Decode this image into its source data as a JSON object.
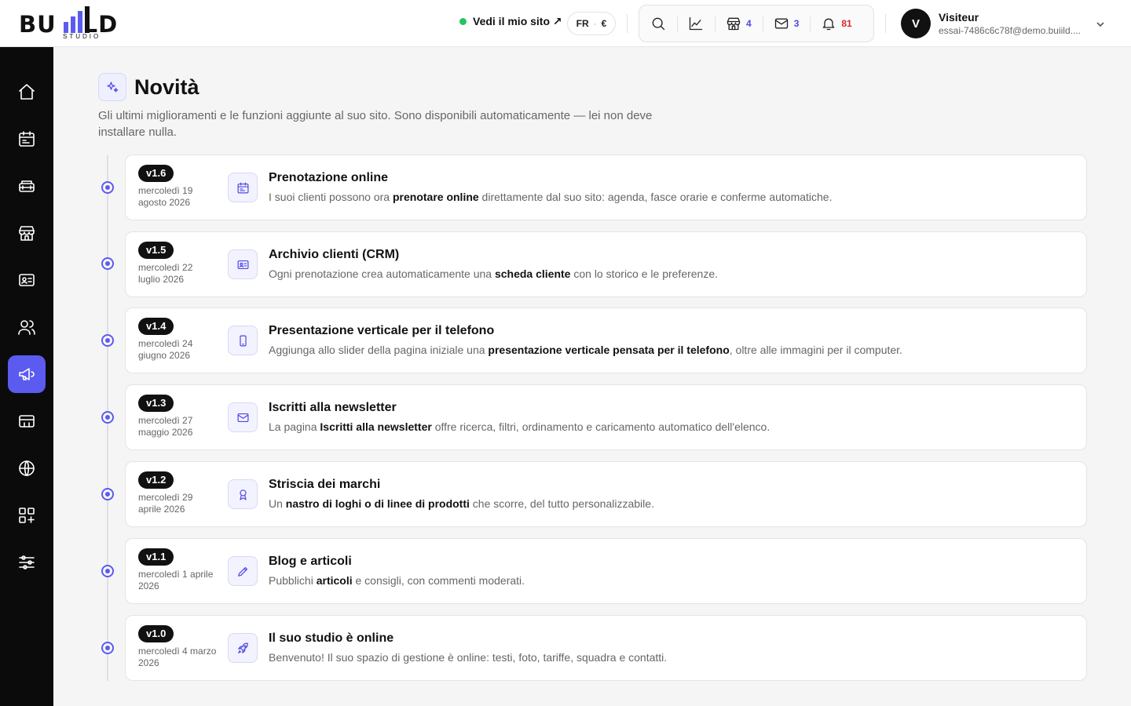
{
  "brand": {
    "name_left": "BU",
    "name_right": "LD",
    "sub": "STUDIO",
    "accent": "#5b5bf0"
  },
  "header": {
    "site_link": "Vedi il mio sito ↗",
    "lang": "FR",
    "currency": "€",
    "tools": [
      {
        "icon": "search-icon"
      },
      {
        "icon": "chart-icon"
      },
      {
        "icon": "store-icon",
        "count": "4"
      },
      {
        "icon": "mail-icon",
        "count": "3"
      },
      {
        "icon": "bell-icon",
        "count": "81"
      }
    ],
    "user": {
      "initial": "V",
      "name": "Visiteur",
      "email": "essai-7486c6c78f@demo.buiild...."
    }
  },
  "sidebar": {
    "items": [
      {
        "name": "home",
        "icon": "home-icon"
      },
      {
        "name": "calendar",
        "icon": "calendar-icon"
      },
      {
        "name": "services",
        "icon": "stack-icon"
      },
      {
        "name": "store",
        "icon": "store-icon"
      },
      {
        "name": "contacts",
        "icon": "id-card-icon"
      },
      {
        "name": "team",
        "icon": "users-icon"
      },
      {
        "name": "announcements",
        "icon": "megaphone-icon",
        "active": true
      },
      {
        "name": "billing",
        "icon": "card-icon"
      },
      {
        "name": "website",
        "icon": "globe-icon"
      },
      {
        "name": "apps",
        "icon": "apps-icon"
      },
      {
        "name": "settings",
        "icon": "sliders-icon"
      }
    ]
  },
  "page": {
    "title": "Novità",
    "description": "Gli ultimi miglioramenti e le funzioni aggiunte al suo sito. Sono disponibili automaticamente — lei non deve installare nulla."
  },
  "releases": [
    {
      "version": "v1.6",
      "date": "mercoledì 19 agosto 2026",
      "icon": "calendar-icon",
      "title": "Prenotazione online",
      "desc": [
        "I suoi clienti possono ora ",
        "prenotare online",
        " direttamente dal suo sito: agenda, fasce orarie e conferme automatiche."
      ]
    },
    {
      "version": "v1.5",
      "date": "mercoledì 22 luglio 2026",
      "icon": "id-card-icon",
      "title": "Archivio clienti (CRM)",
      "desc": [
        "Ogni prenotazione crea automaticamente una ",
        "scheda cliente",
        " con lo storico e le preferenze."
      ]
    },
    {
      "version": "v1.4",
      "date": "mercoledì 24 giugno 2026",
      "icon": "phone-icon",
      "title": "Presentazione verticale per il telefono",
      "desc": [
        "Aggiunga allo slider della pagina iniziale una ",
        "presentazione verticale pensata per il telefono",
        ", oltre alle immagini per il computer."
      ]
    },
    {
      "version": "v1.3",
      "date": "mercoledì 27 maggio 2026",
      "icon": "mail-icon",
      "title": "Iscritti alla newsletter",
      "desc": [
        "La pagina ",
        "Iscritti alla newsletter",
        " offre ricerca, filtri, ordinamento e caricamento automatico dell'elenco."
      ]
    },
    {
      "version": "v1.2",
      "date": "mercoledì 29 aprile 2026",
      "icon": "award-icon",
      "title": "Striscia dei marchi",
      "desc": [
        "Un ",
        "nastro di loghi o di linee di prodotti",
        " che scorre, del tutto personalizzabile."
      ]
    },
    {
      "version": "v1.1",
      "date": "mercoledì 1 aprile 2026",
      "icon": "pencil-icon",
      "title": "Blog e articoli",
      "desc": [
        "Pubblichi ",
        "articoli",
        " e consigli, con commenti moderati."
      ]
    },
    {
      "version": "v1.0",
      "date": "mercoledì 4 marzo 2026",
      "icon": "rocket-icon",
      "title": "Il suo studio è online",
      "desc": [
        "Benvenuto! Il suo spazio di gestione è online: testi, foto, tariffe, squadra e contatti.",
        "",
        ""
      ]
    }
  ]
}
